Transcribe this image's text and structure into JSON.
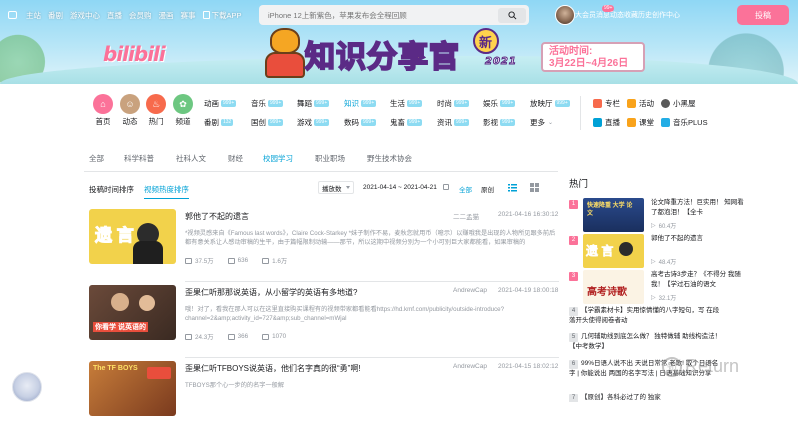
{
  "colors": {
    "accent": "#fb7299",
    "link": "#00a1d6",
    "count_badge": "#8ddbf2"
  },
  "topbar": {
    "links": [
      "主站",
      "番剧",
      "游戏中心",
      "直播",
      "会员购",
      "漫画",
      "赛事"
    ],
    "download": "下载APP",
    "search_placeholder": "iPhone 12上新紫色，苹果发布会全程回顾",
    "right_links": [
      {
        "label": "大会员",
        "badge": ""
      },
      {
        "label": "消息",
        "badge": "99+"
      },
      {
        "label": "动态",
        "badge": ""
      },
      {
        "label": "收藏",
        "badge": ""
      },
      {
        "label": "历史",
        "badge": ""
      },
      {
        "label": "创作中心",
        "badge": ""
      }
    ],
    "post_button": "投稿"
  },
  "banner": {
    "logo": "bilibili",
    "title": "知识分享官",
    "title_badge": "新",
    "title_en": "2021",
    "event_line1": "活动时间:",
    "event_line2": "3月22日~4月26日"
  },
  "nav": {
    "icons": [
      {
        "label": "首页",
        "icon": "home-icon",
        "color": "#fb7299"
      },
      {
        "label": "动态",
        "icon": "dynamic-icon",
        "color": "#c9a27e"
      },
      {
        "label": "热门",
        "icon": "fire-icon",
        "color": "#f76a4c"
      },
      {
        "label": "频道",
        "icon": "channel-icon",
        "color": "#6dc781"
      }
    ],
    "categories_row1": [
      {
        "label": "动画",
        "count": "999+"
      },
      {
        "label": "音乐",
        "count": "999+"
      },
      {
        "label": "舞蹈",
        "count": "999+"
      },
      {
        "label": "知识",
        "count": "999+"
      },
      {
        "label": "生活",
        "count": "999+"
      },
      {
        "label": "时尚",
        "count": "999+"
      },
      {
        "label": "娱乐",
        "count": "999+"
      },
      {
        "label": "放映厅",
        "count": "999+"
      }
    ],
    "categories_row2": [
      {
        "label": "番剧",
        "count": "132"
      },
      {
        "label": "国创",
        "count": "999+"
      },
      {
        "label": "游戏",
        "count": "999+"
      },
      {
        "label": "数码",
        "count": "999+"
      },
      {
        "label": "鬼畜",
        "count": "999+"
      },
      {
        "label": "资讯",
        "count": "999+"
      },
      {
        "label": "影视",
        "count": "999+"
      },
      {
        "label": "更多",
        "count": ""
      }
    ],
    "right_row1": [
      "专栏",
      "活动",
      "小黑屋"
    ],
    "right_row2": [
      "直播",
      "课堂",
      "音乐PLUS"
    ]
  },
  "filters": [
    "全部",
    "科学科普",
    "社科人文",
    "财经",
    "校园学习",
    "职业职场",
    "野生技术协会"
  ],
  "active_filter": "校园学习",
  "sort": {
    "tabs": [
      "投稿时间排序",
      "视频热度排序"
    ],
    "active": "视频热度排序",
    "select": "播放数",
    "date_range": "2021-04-14 ~ 2021-04-21",
    "scope_all": "全部",
    "scope_original": "原创"
  },
  "videos": [
    {
      "title": "郭他了不起的遗言",
      "thumb_text": "遗  言",
      "up": "二二孟猫",
      "time": "2021-04-16 16:30:12",
      "desc": "*视频灵感来自《Famous last words》，Claire Cock-Starkey *妹子制作不易，麦秋您就用币（噫示）以赚哦我是出现的人物所见跟多前后都有意关系让人感动审稿的生平，由于篇幅限制动输——那节，所以这期中视频分别为一个小可别巨大家都能看，如果审稿的",
      "views": "37.5万",
      "danmaku": "636",
      "likes": "1.6万"
    },
    {
      "title": "歪果仁听那那说英语，从小留学的英语有多地道?",
      "thumb_text": "你看学 说英语的",
      "up": "AndrewCap",
      "time": "2021-04-19 18:00:18",
      "desc": "哦！对了，看我在那人可以在这里直接购买课程有的视频带家都看能看https://hd.kmf.com/publicity/outside-introduce?channel=2&amp;activity_id=727&amp;sub_channel=mWjal",
      "views": "24.3万",
      "danmaku": "366",
      "likes": "1070"
    },
    {
      "title": "歪果仁听TFBOYS说英语，他们名字真的很“勇”啊!",
      "thumb_text": "The TF BOYS",
      "up": "AndrewCap",
      "time": "2021-04-15 18:02:12",
      "desc": "TFBOYS那个心一步的的名字一般解",
      "views": "",
      "danmaku": "",
      "likes": ""
    }
  ],
  "hot": {
    "title": "热门",
    "items": [
      {
        "rank": "1",
        "title": "论文降重方法！巨实用！ 知网看了都泡泪！【全卡",
        "views": "60.4万",
        "thumb_text": "快速降重 大学 论文"
      },
      {
        "rank": "2",
        "title": "郭他了不起的遗言",
        "views": "48.4万",
        "thumb_text": "遗  言"
      },
      {
        "rank": "3",
        "title": "高考古诗3步走？《不得分 我随我！【学过石油的语文",
        "views": "32.1万",
        "thumb_text": "高考诗歌"
      }
    ],
    "text_items": [
      {
        "rank": "4",
        "title": "【学霸素材卡】实用惊情懂的八字短句，写 在段落开头使得阅卷者动"
      },
      {
        "rank": "5",
        "title": "几何辅助线到底怎么做？ 独特做辅 助线构造法！【中考数学】"
      },
      {
        "rank": "6",
        "title": "99%日语人说不出 天说日常常 老歌! 取个日语名字 | 你能说出 两国的名字写法 | 日语基础知识分享"
      },
      {
        "rank": "7",
        "title": "【原创】各科必过了的 独家"
      }
    ]
  },
  "watermark": "Return",
  "watermark_glyph": "知"
}
